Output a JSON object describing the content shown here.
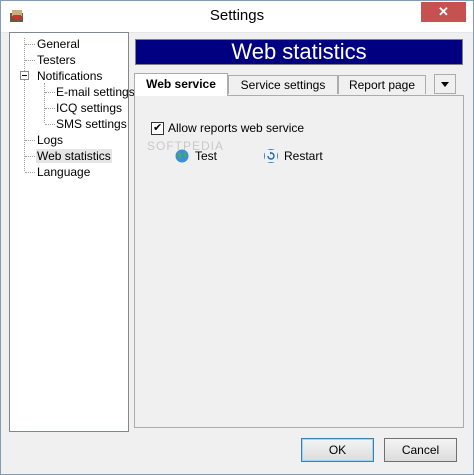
{
  "window": {
    "title": "Settings",
    "close_glyph": "✕"
  },
  "tree": {
    "items": [
      {
        "label": "General"
      },
      {
        "label": "Testers"
      },
      {
        "label": "Notifications",
        "expanded": true
      },
      {
        "label": "E-mail settings"
      },
      {
        "label": "ICQ settings"
      },
      {
        "label": "SMS settings"
      },
      {
        "label": "Logs"
      },
      {
        "label": "Web statistics",
        "selected": true
      },
      {
        "label": "Language"
      }
    ]
  },
  "banner": {
    "title": "Web statistics",
    "bg_color": "#000080"
  },
  "tabs": [
    {
      "label": "Web service",
      "active": true
    },
    {
      "label": "Service settings"
    },
    {
      "label": "Report page"
    }
  ],
  "panel": {
    "allow_reports": {
      "label": "Allow reports web service",
      "checked": true,
      "check_glyph": "✔"
    },
    "test_button": {
      "label": "Test",
      "icon": "globe-icon"
    },
    "restart_button": {
      "label": "Restart",
      "icon": "restart-icon"
    },
    "watermark": "SOFTPEDIA"
  },
  "footer": {
    "ok_label": "OK",
    "cancel_label": "Cancel"
  }
}
